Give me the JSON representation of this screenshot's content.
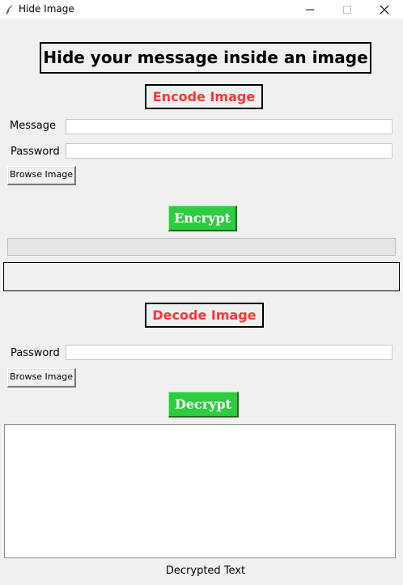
{
  "window": {
    "title": "Hide Image",
    "app_icon": "feather-icon"
  },
  "headline": "Hide your message inside an image",
  "encode": {
    "title": "Encode Image",
    "message_label": "Message",
    "message_value": "",
    "password_label": "Password",
    "password_value": "",
    "browse_label": "Browse Image",
    "encrypt_label": "Encrypt",
    "progress": 0,
    "status_text": ""
  },
  "decode": {
    "title": "Decode Image",
    "password_label": "Password",
    "password_value": "",
    "browse_label": "Browse Image",
    "decrypt_label": "Decrypt",
    "output_text": "",
    "output_label": "Decrypted Text"
  },
  "colors": {
    "section_title": "#ff3333",
    "action_button": "#2ecc40",
    "background": "#f0f0f0"
  }
}
